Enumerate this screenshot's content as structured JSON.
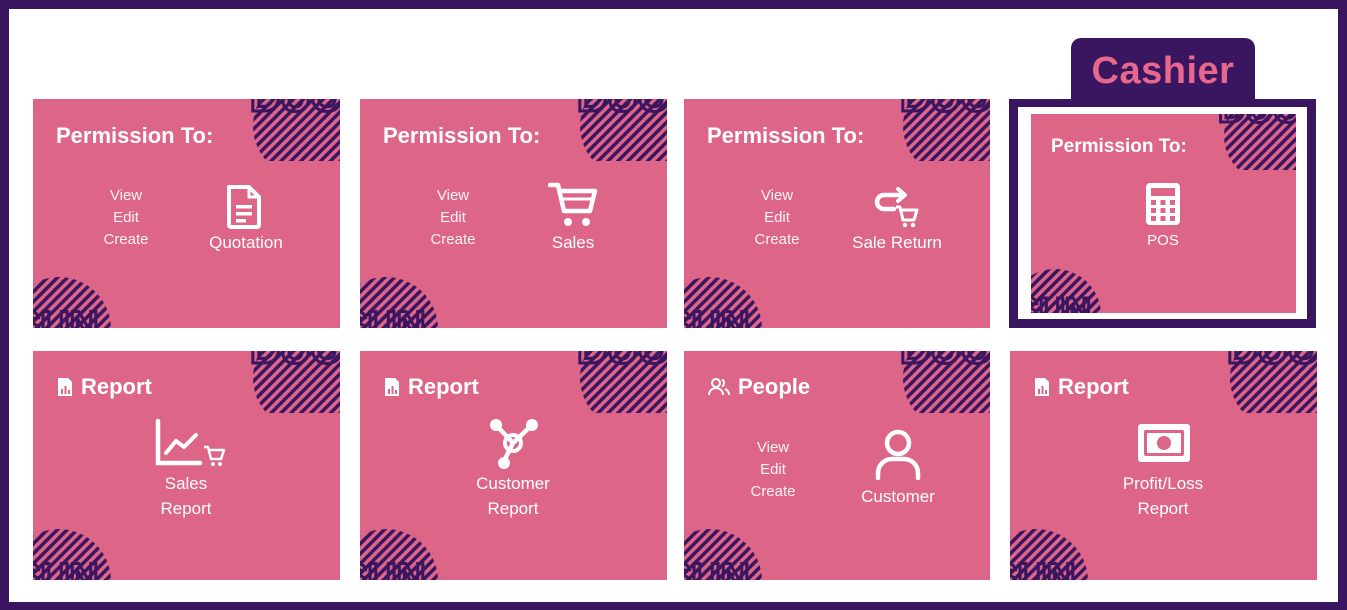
{
  "header": {
    "role_tab": "Cashier"
  },
  "permissions": {
    "view": "View",
    "edit": "Edit",
    "create": "Create"
  },
  "cards": {
    "quotation": {
      "title": "Permission To:",
      "feature": "Quotation"
    },
    "sales": {
      "title": "Permission To:",
      "feature": "Sales"
    },
    "sale_return": {
      "title": "Permission To:",
      "feature": "Sale Return"
    },
    "pos": {
      "title": "Permission To:",
      "feature": "POS"
    },
    "sales_report": {
      "header": "Report",
      "line1": "Sales",
      "line2": "Report"
    },
    "customer_report": {
      "header": "Report",
      "line1": "Customer",
      "line2": "Report"
    },
    "customer": {
      "header": "People",
      "feature": "Customer"
    },
    "profit_loss": {
      "header": "Report",
      "line1": "Profit/Loss",
      "line2": "Report"
    }
  },
  "colors": {
    "frame": "#3b1660",
    "card": "#dd6587",
    "accent": "#e8678d"
  },
  "icons": [
    "document-icon",
    "cart-icon",
    "return-cart-icon",
    "calculator-icon",
    "report-icon",
    "chart-cart-icon",
    "network-icon",
    "people-icon",
    "user-icon",
    "money-icon"
  ]
}
